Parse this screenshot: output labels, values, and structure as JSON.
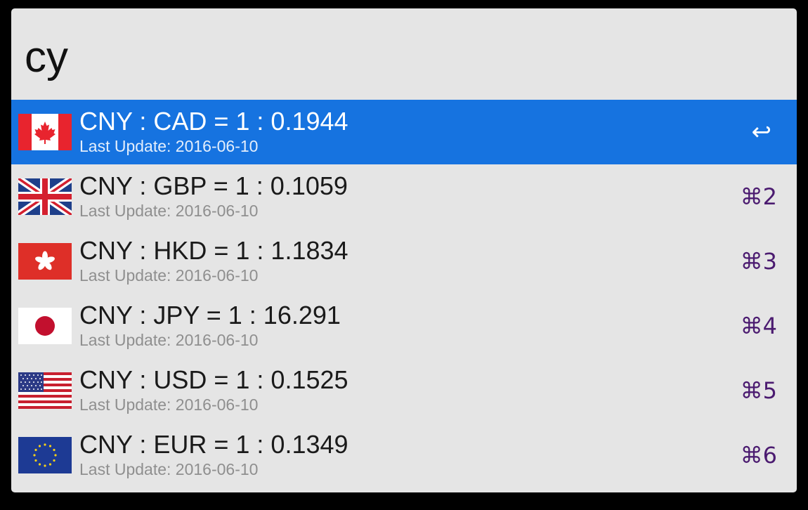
{
  "search": {
    "query": "cy"
  },
  "results": [
    {
      "title": "CNY : CAD = 1 : 0.1944",
      "subtitle": "Last Update: 2016-06-10",
      "shortcut": "↩",
      "flag_icon": "canada-flag-icon",
      "selected": true
    },
    {
      "title": "CNY : GBP = 1 : 0.1059",
      "subtitle": "Last Update: 2016-06-10",
      "shortcut": "⌘2",
      "flag_icon": "uk-flag-icon",
      "selected": false
    },
    {
      "title": "CNY : HKD = 1 : 1.1834",
      "subtitle": "Last Update: 2016-06-10",
      "shortcut": "⌘3",
      "flag_icon": "hong-kong-flag-icon",
      "selected": false
    },
    {
      "title": "CNY : JPY = 1 : 16.291",
      "subtitle": "Last Update: 2016-06-10",
      "shortcut": "⌘4",
      "flag_icon": "japan-flag-icon",
      "selected": false
    },
    {
      "title": "CNY : USD = 1 : 0.1525",
      "subtitle": "Last Update: 2016-06-10",
      "shortcut": "⌘5",
      "flag_icon": "usa-flag-icon",
      "selected": false
    },
    {
      "title": "CNY : EUR = 1 : 0.1349",
      "subtitle": "Last Update: 2016-06-10",
      "shortcut": "⌘6",
      "flag_icon": "eu-flag-icon",
      "selected": false
    }
  ],
  "colors": {
    "selection": "#1673e0",
    "background": "#e5e5e5",
    "shortcut": "#4b1b70"
  }
}
